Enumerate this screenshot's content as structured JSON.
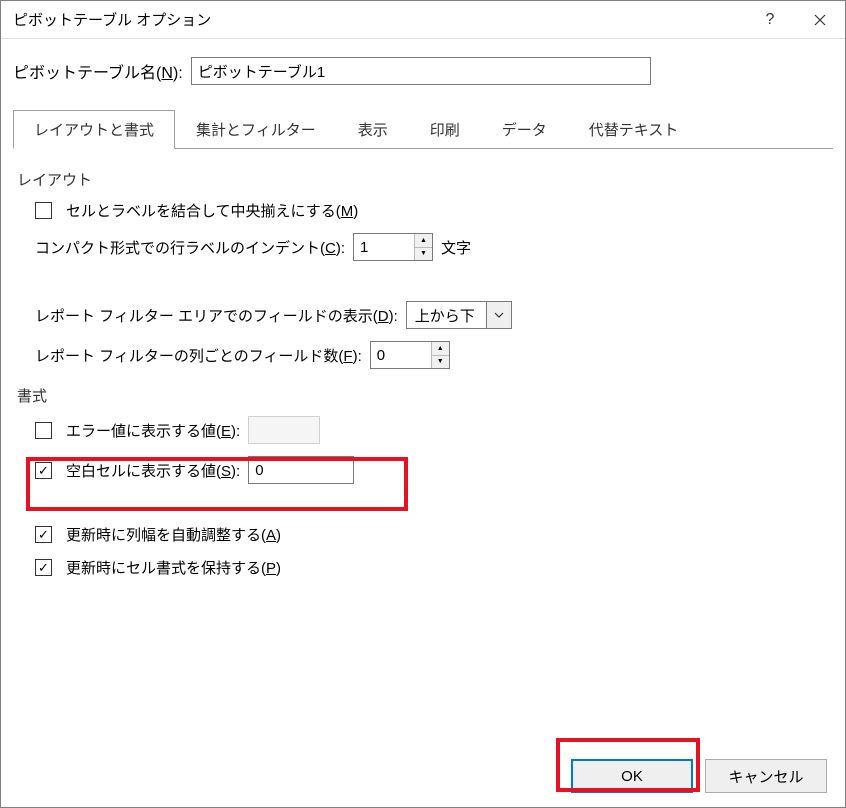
{
  "title": "ピボットテーブル オプション",
  "name_row": {
    "label_pre": "ピボットテーブル名(",
    "label_key": "N",
    "label_post": "):",
    "value": "ピボットテーブル1"
  },
  "tabs": [
    "レイアウトと書式",
    "集計とフィルター",
    "表示",
    "印刷",
    "データ",
    "代替テキスト"
  ],
  "layout_section": "レイアウト",
  "merge_label_pre": "セルとラベルを結合して中央揃えにする(",
  "merge_key": "M",
  "merge_label_post": ")",
  "indent_label_pre": "コンパクト形式での行ラベルのインデント(",
  "indent_key": "C",
  "indent_label_post": "):",
  "indent_value": "1",
  "indent_suffix": "文字",
  "filter_field_pre": "レポート フィルター エリアでのフィールドの表示(",
  "filter_field_key": "D",
  "filter_field_post": "):",
  "filter_field_value": "上から下",
  "filter_cols_pre": "レポート フィルターの列ごとのフィールド数(",
  "filter_cols_key": "F",
  "filter_cols_post": "):",
  "filter_cols_value": "0",
  "format_section": "書式",
  "error_label_pre": "エラー値に表示する値(",
  "error_key": "E",
  "error_label_post": "):",
  "empty_label_pre": "空白セルに表示する値(",
  "empty_key": "S",
  "empty_label_post": "):",
  "empty_value": "0",
  "autofit_pre": "更新時に列幅を自動調整する(",
  "autofit_key": "A",
  "autofit_post": ")",
  "preserve_pre": "更新時にセル書式を保持する(",
  "preserve_key": "P",
  "preserve_post": ")",
  "ok_label": "OK",
  "cancel_label": "キャンセル"
}
